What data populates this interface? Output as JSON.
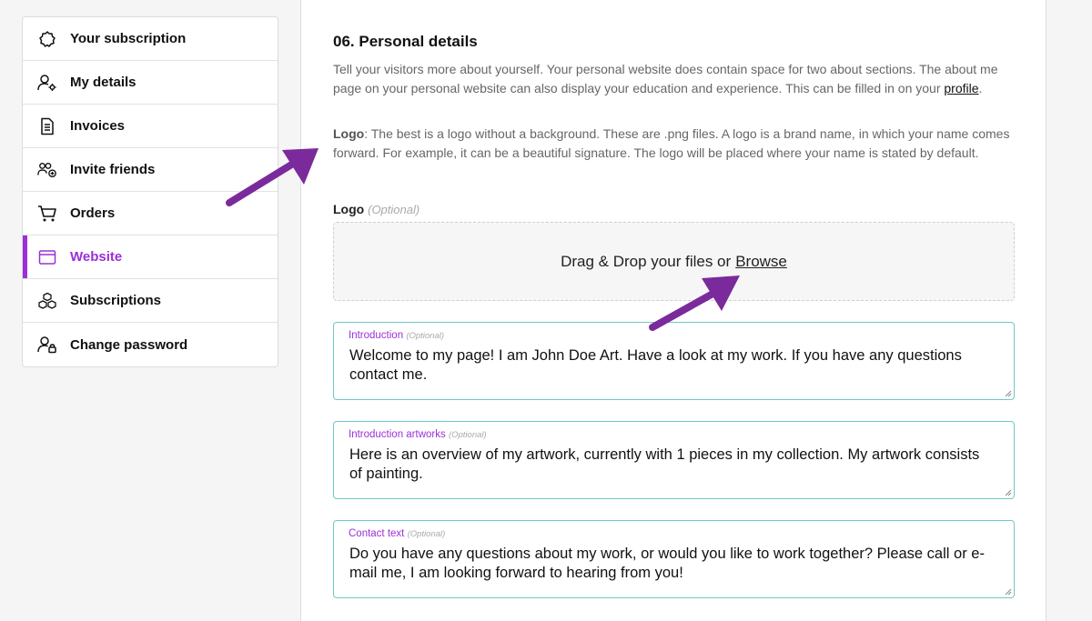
{
  "sidebar": {
    "items": [
      {
        "label": "Your subscription",
        "icon": "badge-icon"
      },
      {
        "label": "My details",
        "icon": "user-gear-icon"
      },
      {
        "label": "Invoices",
        "icon": "invoice-icon"
      },
      {
        "label": "Invite friends",
        "icon": "users-plus-icon"
      },
      {
        "label": "Orders",
        "icon": "cart-icon"
      },
      {
        "label": "Website",
        "icon": "browser-window-icon",
        "active": true
      },
      {
        "label": "Subscriptions",
        "icon": "cubes-icon"
      },
      {
        "label": "Change password",
        "icon": "user-lock-icon"
      }
    ]
  },
  "section": {
    "title": "06. Personal details",
    "intro": "Tell your visitors more about yourself. Your personal website does contain space for two about sections. The about me page on your personal website can also display your education and experience. This can be filled in on your ",
    "profile_link": "profile",
    "intro_end": ".",
    "logo_term": "Logo",
    "logo_desc": ": The best is a logo without a background. These are .png files. A logo is a brand name, in which your name comes forward. For example, it can be a beautiful signature. The logo will be placed where your name is stated by default."
  },
  "logo_field": {
    "label": "Logo",
    "optional": "(Optional)",
    "dropzone_text": "Drag & Drop your files or",
    "browse": "Browse"
  },
  "textareas": [
    {
      "label": "Introduction",
      "optional": "(Optional)",
      "value": "Welcome to my page! I am John Doe Art. Have a look at my work. If you have any questions contact me."
    },
    {
      "label": "Introduction artworks",
      "optional": "(Optional)",
      "value": "Here is an overview of my artwork, currently with 1 pieces in my collection. My artwork consists of painting."
    },
    {
      "label": "Contact text",
      "optional": "(Optional)",
      "value": "Do you have any questions about my work, or would you like to work together? Please call or e-mail me, I am looking forward to hearing from you!"
    }
  ],
  "colors": {
    "accent": "#9b30d9",
    "arrow": "#7b2a9c",
    "field_border": "#6fc9c4"
  }
}
